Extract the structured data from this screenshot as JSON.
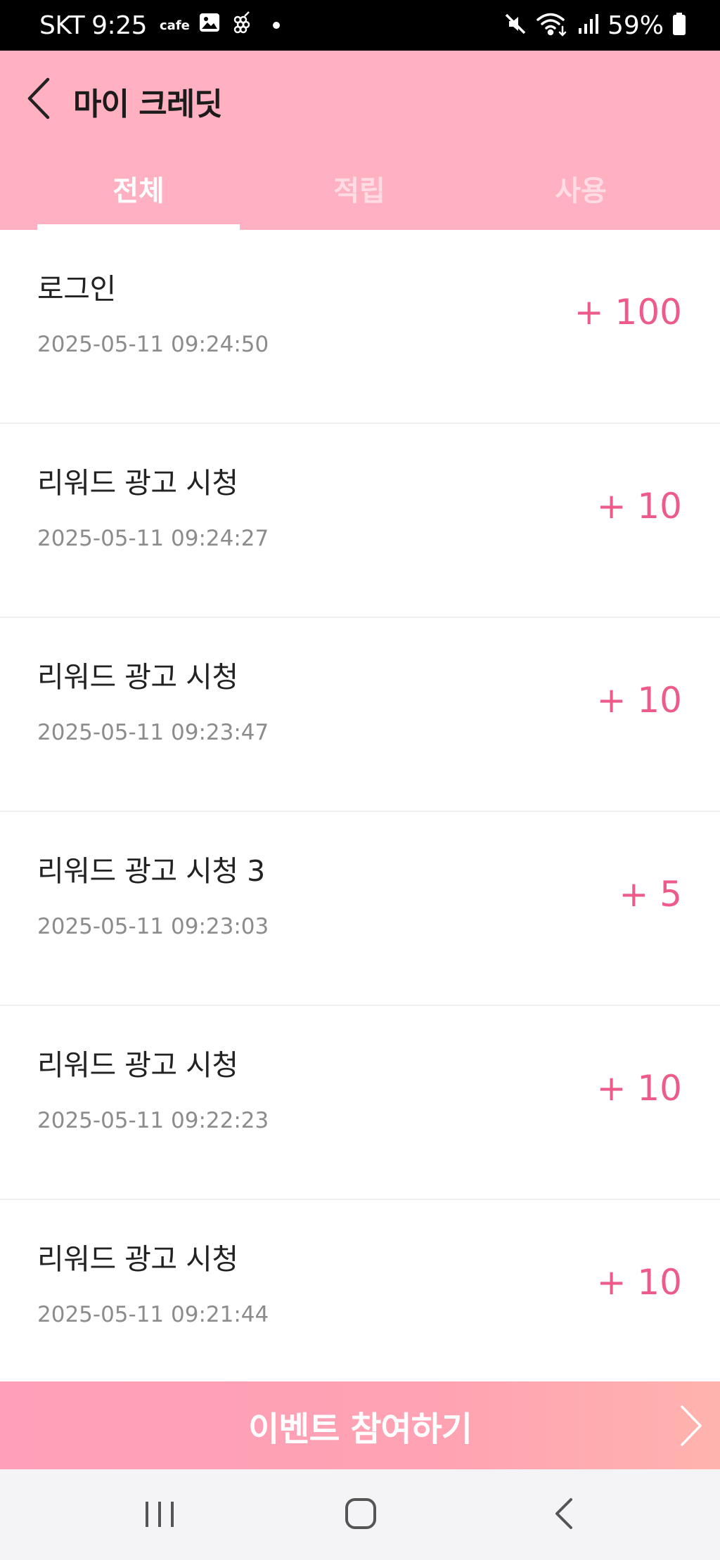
{
  "status_bar": {
    "carrier": "SKT",
    "time": "9:25",
    "cafe_label": "cafe",
    "battery": "59%"
  },
  "header": {
    "title": "마이 크레딧",
    "back_icon": "chevron-left-icon"
  },
  "tabs": [
    {
      "label": "전체",
      "active": true
    },
    {
      "label": "적립",
      "active": false
    },
    {
      "label": "사용",
      "active": false
    }
  ],
  "credits": [
    {
      "title": "로그인",
      "date": "2025-05-11 09:24:50",
      "amount": "+ 100"
    },
    {
      "title": "리워드 광고 시청",
      "date": "2025-05-11 09:24:27",
      "amount": "+ 10"
    },
    {
      "title": "리워드 광고 시청",
      "date": "2025-05-11 09:23:47",
      "amount": "+ 10"
    },
    {
      "title": "리워드 광고 시청 3",
      "date": "2025-05-11 09:23:03",
      "amount": "+ 5"
    },
    {
      "title": "리워드 광고 시청",
      "date": "2025-05-11 09:22:23",
      "amount": "+ 10"
    },
    {
      "title": "리워드 광고 시청",
      "date": "2025-05-11 09:21:44",
      "amount": "+ 10"
    }
  ],
  "event_banner": {
    "label": "이벤트 참여하기",
    "icon": "chevron-right-icon"
  },
  "colors": {
    "header_bg": "#ffb1c2",
    "amount": "#ec5b8a",
    "banner_start": "#ff9fb9",
    "banner_end": "#ffb3ae"
  },
  "nav": {
    "icons": [
      "recent-apps-icon",
      "home-icon",
      "back-icon"
    ]
  }
}
